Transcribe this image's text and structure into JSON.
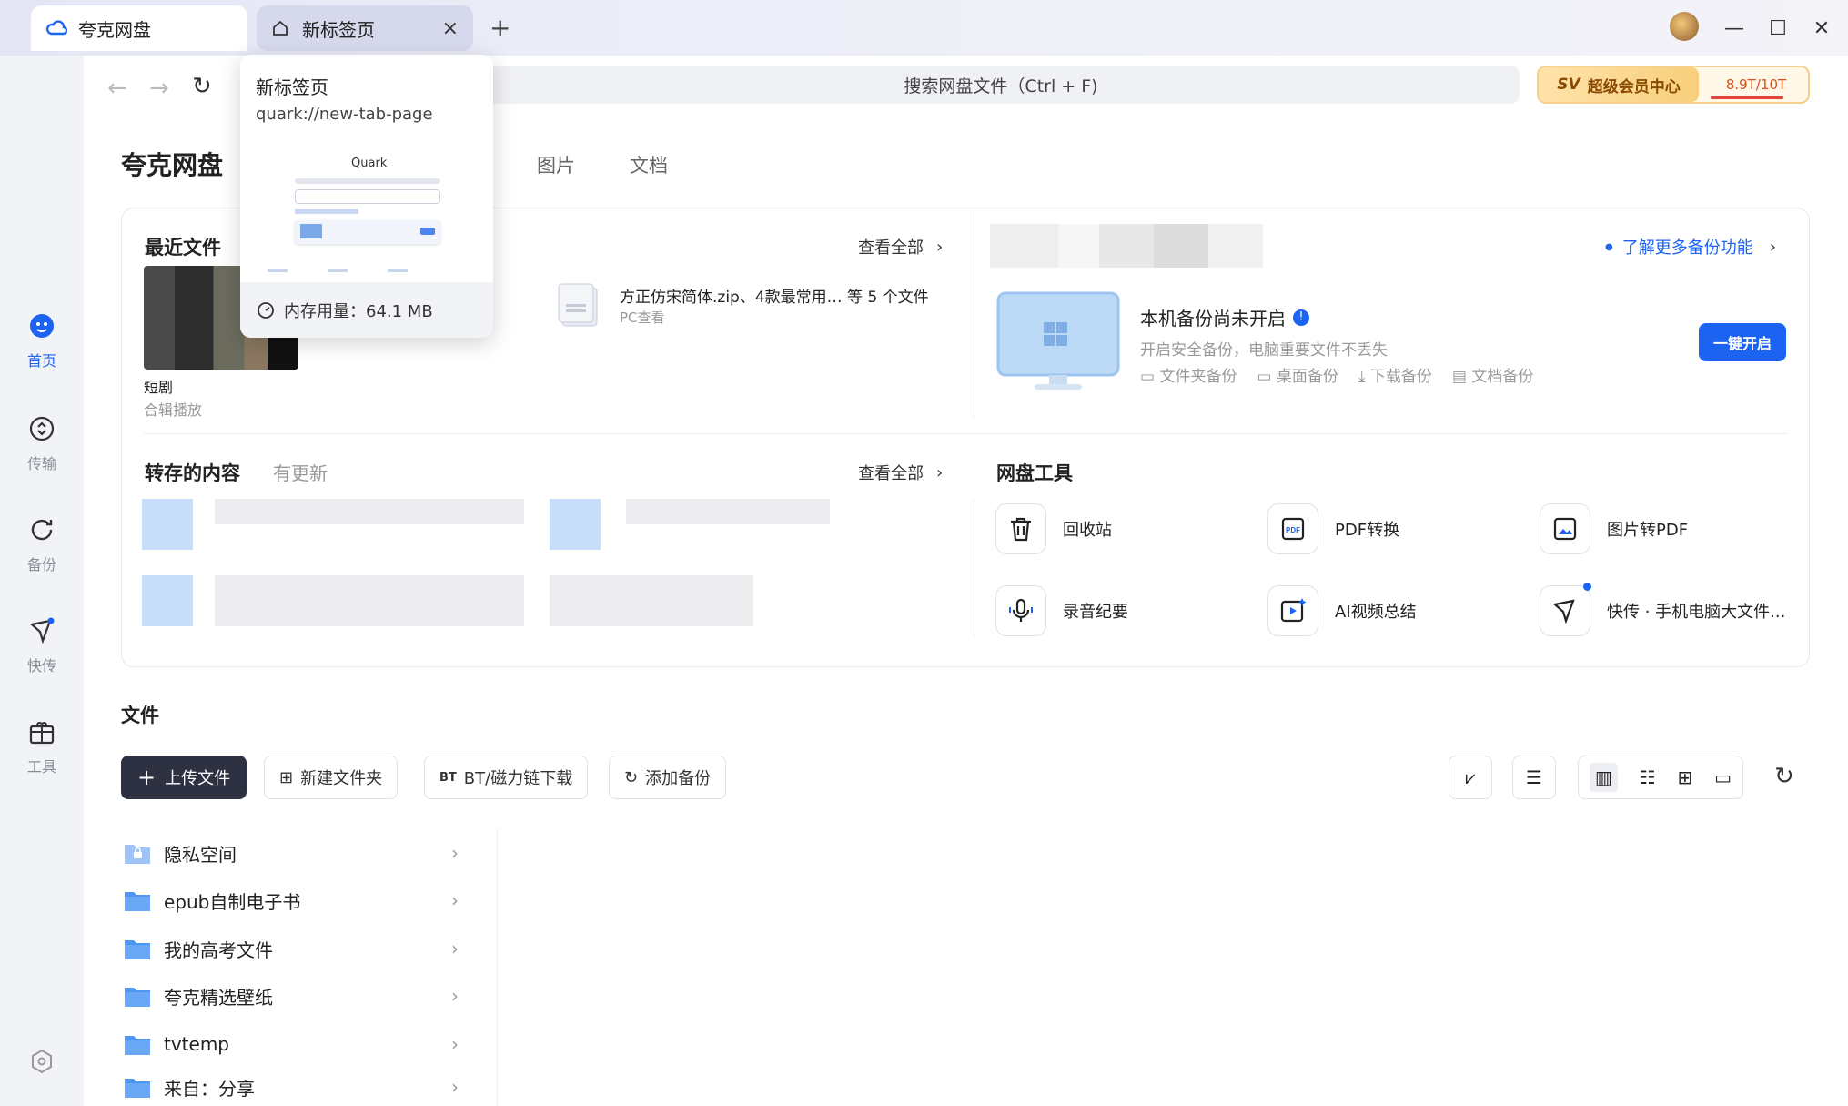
{
  "tabs": [
    {
      "label": "夸克网盘"
    },
    {
      "label": "新标签页",
      "close": "×"
    }
  ],
  "new_tab_symbol": "+",
  "window_controls": {
    "minimize": "—",
    "maximize": "☐",
    "close": "✕"
  },
  "search": {
    "placeholder": "搜索网盘文件（Ctrl + F)"
  },
  "vip": {
    "label": "超级会员中心",
    "storage": "8.9T/10T",
    "storage_used_fraction": 0.89
  },
  "app_title": "夸克网盘",
  "top_tabs": [
    "图片",
    "文档"
  ],
  "sidebar": [
    {
      "label": "首页",
      "icon": "home-icon",
      "active": true
    },
    {
      "label": "传输",
      "icon": "transfer-icon"
    },
    {
      "label": "备份",
      "icon": "backup-icon"
    },
    {
      "label": "快传",
      "icon": "quick-send-icon"
    },
    {
      "label": "工具",
      "icon": "toolbox-icon"
    }
  ],
  "recent": {
    "title": "最近文件",
    "view_all": "查看全部",
    "items": [
      {
        "name": "短剧",
        "sub": "合辑播放"
      },
      {
        "name": "方正仿宋简体.zip、4款最常用… 等 5 个文件",
        "sub": "PC查看"
      }
    ]
  },
  "backup": {
    "more_link": "了解更多备份功能",
    "title": "本机备份尚未开启",
    "desc": "开启安全备份，电脑重要文件不丢失",
    "options": [
      "文件夹备份",
      "桌面备份",
      "下载备份",
      "文档备份"
    ],
    "button": "一键开启"
  },
  "saved": {
    "title": "转存的内容",
    "subtitle": "有更新",
    "view_all": "查看全部"
  },
  "tools": {
    "title": "网盘工具",
    "items": [
      {
        "label": "回收站",
        "icon": "trash-icon"
      },
      {
        "label": "PDF转换",
        "icon": "pdf-icon"
      },
      {
        "label": "图片转PDF",
        "icon": "image-to-pdf-icon"
      },
      {
        "label": "录音纪要",
        "icon": "microphone-icon"
      },
      {
        "label": "AI视频总结",
        "icon": "ai-video-icon"
      },
      {
        "label": "快传 · 手机电脑大文件...",
        "icon": "quick-send-icon"
      }
    ]
  },
  "files": {
    "title": "文件",
    "buttons": {
      "upload": "上传文件",
      "new_folder": "新建文件夹",
      "bt": "BT/磁力链下载",
      "add_backup": "添加备份"
    },
    "list": [
      {
        "name": "隐私空间",
        "icon": "lock-folder-icon"
      },
      {
        "name": "epub自制电子书",
        "icon": "folder-icon"
      },
      {
        "name": "我的高考文件",
        "icon": "folder-icon"
      },
      {
        "name": "夸克精选壁纸",
        "icon": "folder-icon"
      },
      {
        "name": "tvtemp",
        "icon": "folder-icon"
      },
      {
        "name": "来自：分享",
        "icon": "folder-icon"
      }
    ]
  },
  "popup": {
    "title": "新标签页",
    "url": "quark://new-tab-page",
    "thumb_brand": "Quark",
    "memory": "内存用量：64.1 MB"
  },
  "colors": {
    "accent": "#1d63f2",
    "dark_button": "#2d3142",
    "vip_gold": "#f7cf7b"
  }
}
